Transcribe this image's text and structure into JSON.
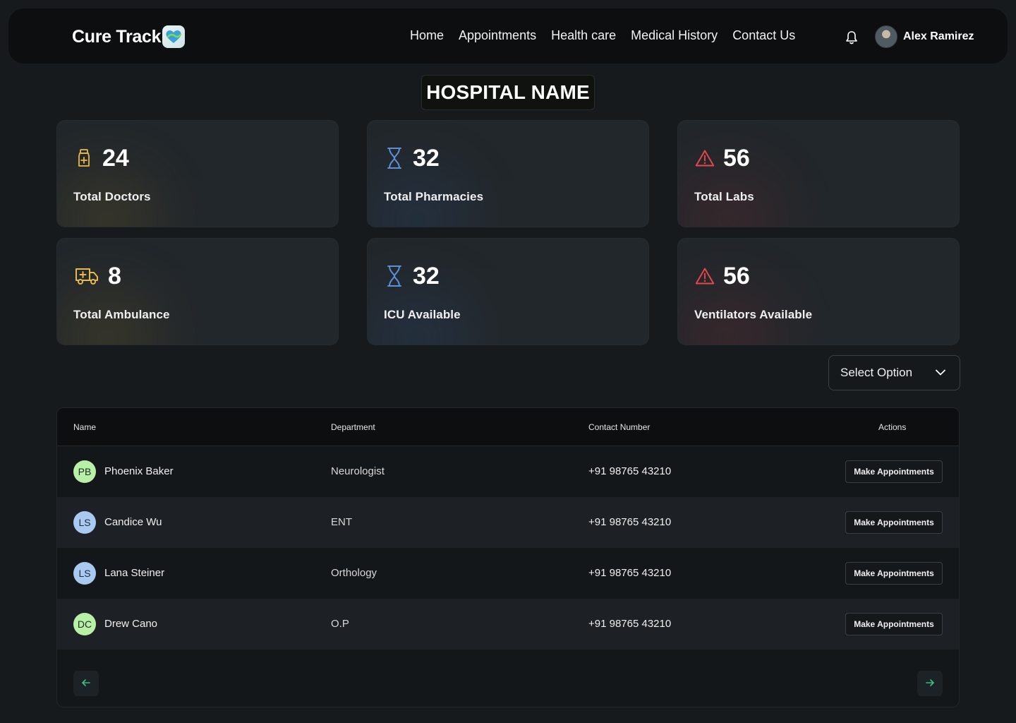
{
  "app": {
    "logo_text": "Cure Track"
  },
  "nav": {
    "links": [
      "Home",
      "Appointments",
      "Health care",
      "Medical History",
      "Contact Us"
    ],
    "user_name": "Alex Ramirez"
  },
  "hospital": {
    "title": "HOSPITAL NAME"
  },
  "stats": [
    {
      "value": "24",
      "label": "Total Doctors",
      "icon": "medicine-bottle-icon",
      "color": "#e8b84a"
    },
    {
      "value": "32",
      "label": "Total Pharmacies",
      "icon": "hourglass-icon",
      "color": "#5b8fd6"
    },
    {
      "value": "56",
      "label": "Total Labs",
      "icon": "warning-icon",
      "color": "#e5484d"
    },
    {
      "value": "8",
      "label": "Total Ambulance",
      "icon": "ambulance-icon",
      "color": "#e8b84a"
    },
    {
      "value": "32",
      "label": "ICU Available",
      "icon": "hourglass-icon",
      "color": "#5b8fd6"
    },
    {
      "value": "56",
      "label": "Ventilators Available",
      "icon": "warning-icon",
      "color": "#e5484d"
    }
  ],
  "filter": {
    "placeholder": "Select Option"
  },
  "table": {
    "columns": [
      "Name",
      "Department",
      "Contact Number",
      "Actions"
    ],
    "rows": [
      {
        "initials": "PB",
        "name": "Phoenix Baker",
        "department": "Neurologist",
        "phone": "+91 98765 43210",
        "action": "Make Appointments"
      },
      {
        "initials": "LS",
        "name": "Candice Wu",
        "department": "ENT",
        "phone": "+91 98765 43210",
        "action": "Make Appointments"
      },
      {
        "initials": "LS",
        "name": "Lana Steiner",
        "department": "Orthology",
        "phone": "+91 98765 43210",
        "action": "Make Appointments"
      },
      {
        "initials": "DC",
        "name": "Drew Cano",
        "department": "O.P",
        "phone": "+91 98765 43210",
        "action": "Make Appointments"
      }
    ]
  },
  "colors": {
    "accent_green": "#3fbf7f",
    "accent_blue": "#5b8fd6",
    "accent_yellow": "#e8b84a",
    "accent_red": "#e5484d"
  }
}
